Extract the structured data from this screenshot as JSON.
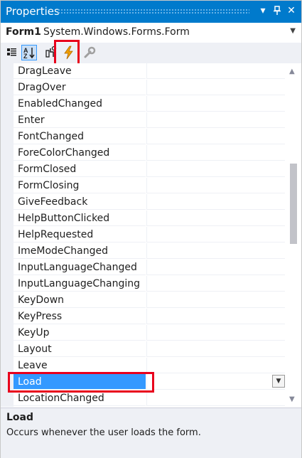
{
  "window": {
    "title": "Properties"
  },
  "title_controls": {
    "dropdown": "▾",
    "pin": "📌",
    "close": "✕"
  },
  "object_selector": {
    "name": "Form1",
    "type": "System.Windows.Forms.Form"
  },
  "toolbar": {
    "buttons": [
      "categorized-icon",
      "alphabetical-icon",
      "properties-icon",
      "events-icon",
      "property-pages-icon"
    ],
    "active": "events-icon"
  },
  "events": [
    {
      "name": "DragLeave"
    },
    {
      "name": "DragOver"
    },
    {
      "name": "EnabledChanged"
    },
    {
      "name": "Enter"
    },
    {
      "name": "FontChanged"
    },
    {
      "name": "ForeColorChanged"
    },
    {
      "name": "FormClosed"
    },
    {
      "name": "FormClosing"
    },
    {
      "name": "GiveFeedback"
    },
    {
      "name": "HelpButtonClicked"
    },
    {
      "name": "HelpRequested"
    },
    {
      "name": "ImeModeChanged"
    },
    {
      "name": "InputLanguageChanged"
    },
    {
      "name": "InputLanguageChanging"
    },
    {
      "name": "KeyDown"
    },
    {
      "name": "KeyPress"
    },
    {
      "name": "KeyUp"
    },
    {
      "name": "Layout"
    },
    {
      "name": "Leave"
    },
    {
      "name": "Load"
    },
    {
      "name": "LocationChanged"
    }
  ],
  "selected_event": "Load",
  "description": {
    "title": "Load",
    "text": "Occurs whenever the user loads the form."
  },
  "colors": {
    "title_bar": "#007acc",
    "selection": "#3399ff",
    "highlight_border": "#e8001c",
    "toolbar_bg": "#eef0f5"
  }
}
